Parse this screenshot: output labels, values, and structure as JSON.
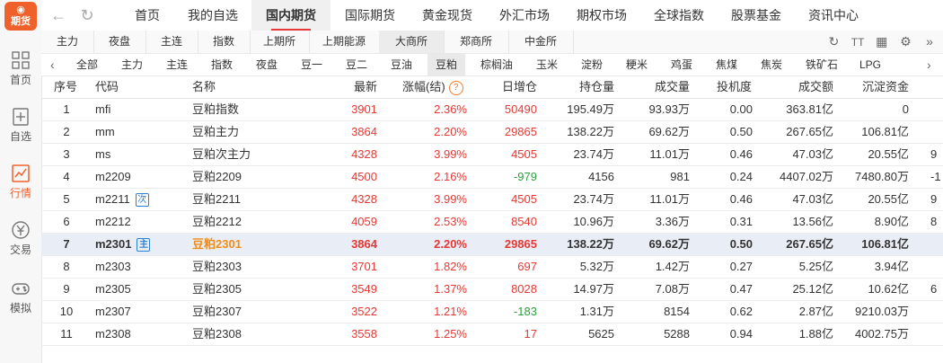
{
  "app": {
    "logo_top": "",
    "logo_text": "期货"
  },
  "sidebar": {
    "items": [
      {
        "label": "首页",
        "icon": "grid-icon"
      },
      {
        "label": "自选",
        "icon": "watchlist-icon"
      },
      {
        "label": "行情",
        "icon": "chart-icon",
        "active": true
      },
      {
        "label": "交易",
        "icon": "yen-icon"
      },
      {
        "label": "模拟",
        "icon": "gamepad-icon"
      }
    ]
  },
  "topnav": {
    "tabs": [
      "首页",
      "我的自选",
      "国内期货",
      "国际期货",
      "黄金现货",
      "外汇市场",
      "期权市场",
      "全球指数",
      "股票基金",
      "资讯中心"
    ],
    "active": "国内期货"
  },
  "subnav": {
    "tabs": [
      "主力",
      "夜盘",
      "主连",
      "指数",
      "上期所",
      "上期能源",
      "大商所",
      "郑商所",
      "中金所"
    ],
    "active": "大商所",
    "tools": {
      "text_size": "TT"
    }
  },
  "filters": {
    "tabs": [
      "全部",
      "主力",
      "主连",
      "指数",
      "夜盘",
      "豆一",
      "豆二",
      "豆油",
      "豆粕",
      "棕榈油",
      "玉米",
      "淀粉",
      "粳米",
      "鸡蛋",
      "焦煤",
      "焦炭",
      "铁矿石",
      "LPG"
    ],
    "active": "豆粕"
  },
  "table": {
    "headers": [
      "序号",
      "代码",
      "名称",
      "最新",
      "涨幅(结)",
      "日增仓",
      "持仓量",
      "成交量",
      "投机度",
      "成交额",
      "沉淀资金"
    ],
    "rows": [
      {
        "idx": "1",
        "code": "mfi",
        "tag": "",
        "name": "豆粕指数",
        "last": "3901",
        "chg": "2.36%",
        "dinc": "50490",
        "oi": "195.49万",
        "vol": "93.93万",
        "spec": "0.00",
        "amt": "363.81亿",
        "fund": "0",
        "extra": ""
      },
      {
        "idx": "2",
        "code": "mm",
        "tag": "",
        "name": "豆粕主力",
        "last": "3864",
        "chg": "2.20%",
        "dinc": "29865",
        "oi": "138.22万",
        "vol": "69.62万",
        "spec": "0.50",
        "amt": "267.65亿",
        "fund": "106.81亿",
        "extra": ""
      },
      {
        "idx": "3",
        "code": "ms",
        "tag": "",
        "name": "豆粕次主力",
        "last": "4328",
        "chg": "3.99%",
        "dinc": "4505",
        "oi": "23.74万",
        "vol": "11.01万",
        "spec": "0.46",
        "amt": "47.03亿",
        "fund": "20.55亿",
        "extra": "9"
      },
      {
        "idx": "4",
        "code": "m2209",
        "tag": "",
        "name": "豆粕2209",
        "last": "4500",
        "chg": "2.16%",
        "dinc": "-979",
        "oi": "4156",
        "vol": "981",
        "spec": "0.24",
        "amt": "4407.02万",
        "fund": "7480.80万",
        "extra": "-1"
      },
      {
        "idx": "5",
        "code": "m2211",
        "tag": "次",
        "name": "豆粕2211",
        "last": "4328",
        "chg": "3.99%",
        "dinc": "4505",
        "oi": "23.74万",
        "vol": "11.01万",
        "spec": "0.46",
        "amt": "47.03亿",
        "fund": "20.55亿",
        "extra": "9"
      },
      {
        "idx": "6",
        "code": "m2212",
        "tag": "",
        "name": "豆粕2212",
        "last": "4059",
        "chg": "2.53%",
        "dinc": "8540",
        "oi": "10.96万",
        "vol": "3.36万",
        "spec": "0.31",
        "amt": "13.56亿",
        "fund": "8.90亿",
        "extra": "8"
      },
      {
        "idx": "7",
        "code": "m2301",
        "tag": "主",
        "name": "豆粕2301",
        "last": "3864",
        "chg": "2.20%",
        "dinc": "29865",
        "oi": "138.22万",
        "vol": "69.62万",
        "spec": "0.50",
        "amt": "267.65亿",
        "fund": "106.81亿",
        "extra": "",
        "selected": true
      },
      {
        "idx": "8",
        "code": "m2303",
        "tag": "",
        "name": "豆粕2303",
        "last": "3701",
        "chg": "1.82%",
        "dinc": "697",
        "oi": "5.32万",
        "vol": "1.42万",
        "spec": "0.27",
        "amt": "5.25亿",
        "fund": "3.94亿",
        "extra": ""
      },
      {
        "idx": "9",
        "code": "m2305",
        "tag": "",
        "name": "豆粕2305",
        "last": "3549",
        "chg": "1.37%",
        "dinc": "8028",
        "oi": "14.97万",
        "vol": "7.08万",
        "spec": "0.47",
        "amt": "25.12亿",
        "fund": "10.62亿",
        "extra": "6"
      },
      {
        "idx": "10",
        "code": "m2307",
        "tag": "",
        "name": "豆粕2307",
        "last": "3522",
        "chg": "1.21%",
        "dinc": "-183",
        "oi": "1.31万",
        "vol": "8154",
        "spec": "0.62",
        "amt": "2.87亿",
        "fund": "9210.03万",
        "extra": ""
      },
      {
        "idx": "11",
        "code": "m2308",
        "tag": "",
        "name": "豆粕2308",
        "last": "3558",
        "chg": "1.25%",
        "dinc": "17",
        "oi": "5625",
        "vol": "5288",
        "spec": "0.94",
        "amt": "1.88亿",
        "fund": "4002.75万",
        "extra": ""
      }
    ]
  },
  "colors": {
    "accent": "#f0602a",
    "up": "#e53935",
    "down": "#2e9e3e",
    "selected_name": "#f08c1a"
  }
}
